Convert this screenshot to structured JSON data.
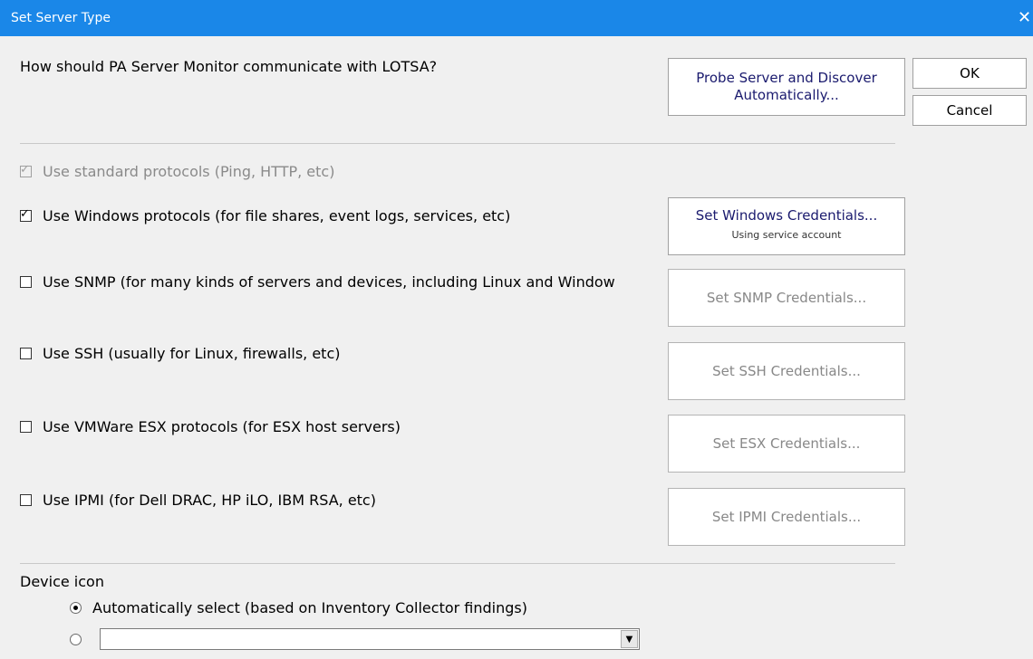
{
  "window": {
    "title": "Set Server Type",
    "close_glyph": "✕",
    "title_bar_color": "#1a87e8"
  },
  "prompt": "How should PA Server Monitor communicate with LOTSA?",
  "buttons": {
    "probe": "Probe Server and Discover Automatically...",
    "ok": "OK",
    "cancel": "Cancel"
  },
  "protocols": [
    {
      "label": "Use standard protocols (Ping, HTTP, etc)",
      "checked": true,
      "disabled": true
    },
    {
      "label": "Use Windows protocols (for file shares, event logs, services, etc)",
      "checked": true,
      "disabled": false,
      "button": "Set Windows Credentials...",
      "button_sub": "Using service account",
      "button_enabled": true
    },
    {
      "label": "Use SNMP (for many kinds of servers and devices, including Linux and Window",
      "checked": false,
      "disabled": false,
      "button": "Set SNMP Credentials...",
      "button_enabled": false
    },
    {
      "label": "Use SSH (usually for Linux, firewalls, etc)",
      "checked": false,
      "disabled": false,
      "button": "Set SSH Credentials...",
      "button_enabled": false
    },
    {
      "label": "Use VMWare ESX protocols (for ESX host servers)",
      "checked": false,
      "disabled": false,
      "button": "Set ESX Credentials...",
      "button_enabled": false
    },
    {
      "label": "Use IPMI (for Dell DRAC, HP iLO, IBM RSA, etc)",
      "checked": false,
      "disabled": false,
      "button": "Set IPMI Credentials...",
      "button_enabled": false
    }
  ],
  "device_icon": {
    "label": "Device icon",
    "auto_option": "Automatically select (based on Inventory Collector findings)",
    "auto_selected": true,
    "manual_selected": false,
    "select_value": "",
    "arrow_glyph": "▼"
  },
  "check_glyph": "✓"
}
